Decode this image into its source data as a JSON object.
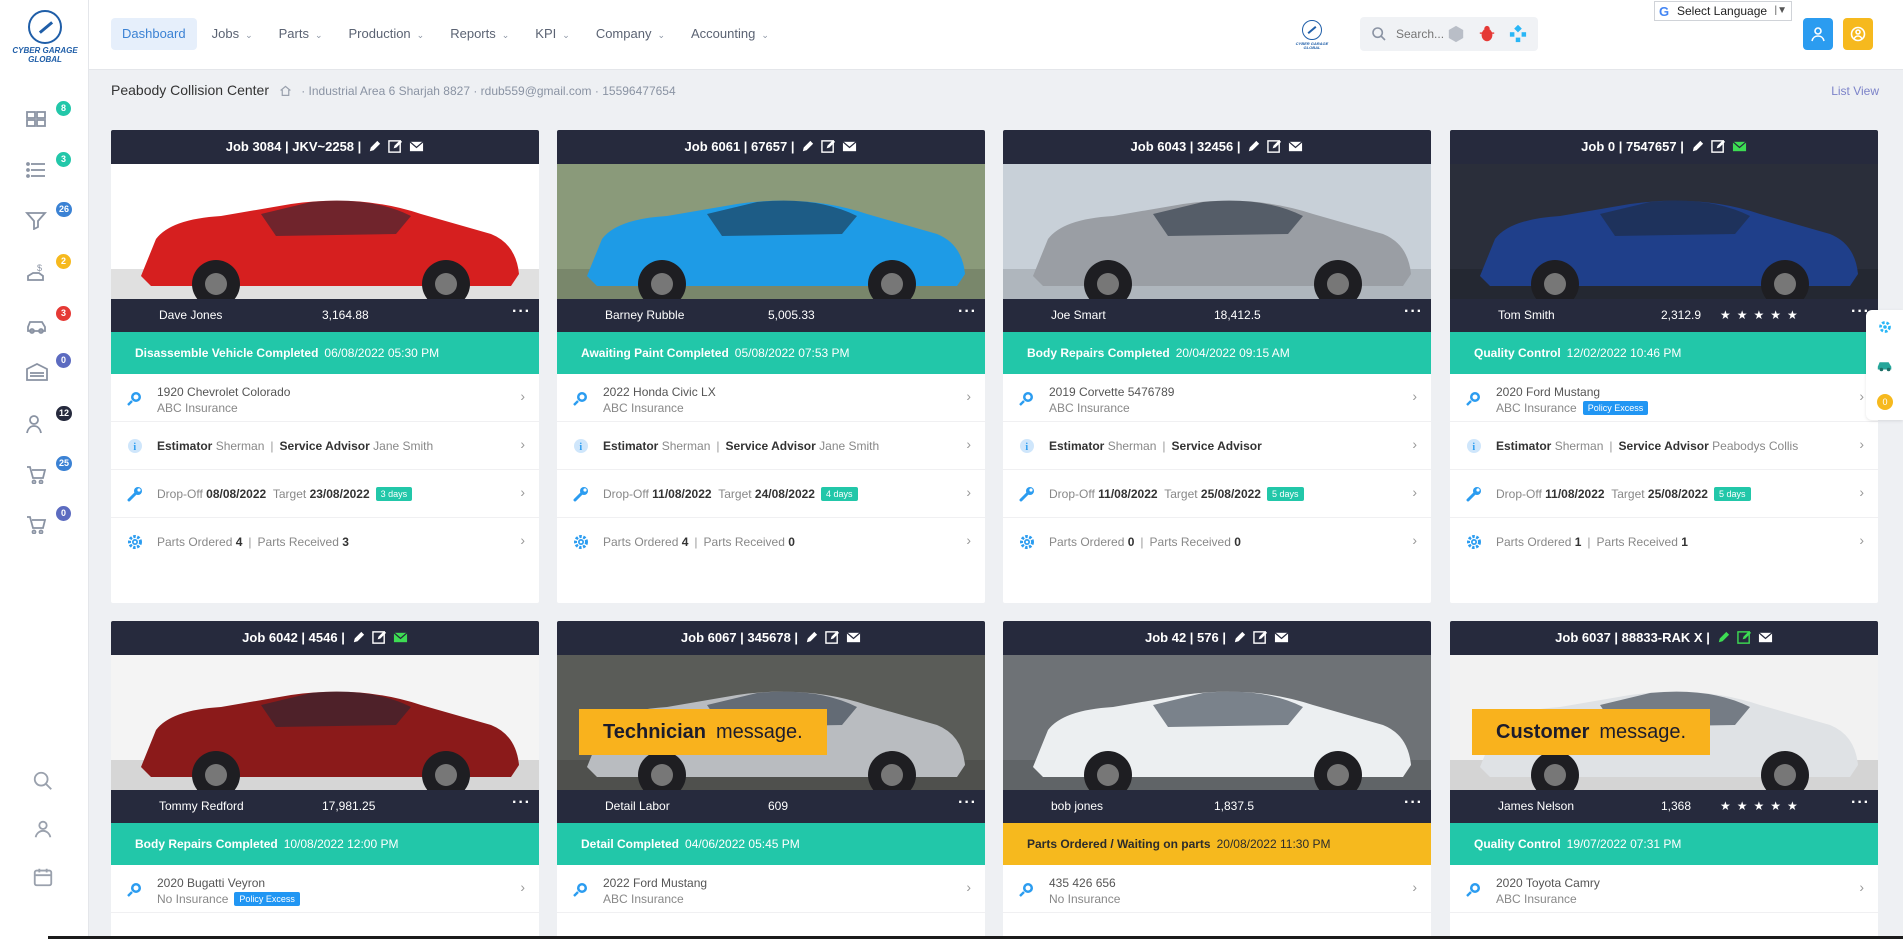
{
  "logo_text": "CYBER GARAGE GLOBAL",
  "sidebar": {
    "items": [
      {
        "name": "dashboard",
        "badge": "8",
        "color": "#22c7a9"
      },
      {
        "name": "list",
        "badge": "3",
        "color": "#22c7a9"
      },
      {
        "name": "parts-cart",
        "badge": "26",
        "color": "#3b82d4"
      },
      {
        "name": "payments",
        "badge": "2",
        "color": "#f6b91e"
      },
      {
        "name": "vehicles",
        "badge": "3",
        "color": "#e53935"
      },
      {
        "name": "garage",
        "badge": "0",
        "color": "#5c6bc0"
      },
      {
        "name": "users",
        "badge": "12",
        "color": "#262a3d"
      },
      {
        "name": "cart",
        "badge": "25",
        "color": "#3b82d4"
      },
      {
        "name": "cart-2",
        "badge": "0",
        "color": "#5c6bc0"
      }
    ]
  },
  "nav": {
    "items": [
      {
        "label": "Dashboard",
        "active": true,
        "dropdown": false
      },
      {
        "label": "Jobs",
        "dropdown": true
      },
      {
        "label": "Parts",
        "dropdown": true
      },
      {
        "label": "Production",
        "dropdown": true
      },
      {
        "label": "Reports",
        "dropdown": true
      },
      {
        "label": "KPI",
        "dropdown": true
      },
      {
        "label": "Company",
        "dropdown": true
      },
      {
        "label": "Accounting",
        "dropdown": true
      }
    ]
  },
  "search": {
    "placeholder": "Search..."
  },
  "language": {
    "label": "Select Language"
  },
  "breadcrumb": {
    "title": "Peabody Collision Center",
    "address": "· Industrial Area 6 Sharjah 8827 · rdub559@gmail.com · 15596477654"
  },
  "list_view": "List View",
  "float_badge": "0",
  "cards": [
    {
      "title": "Job 3084 | JKV~2258 |",
      "customer": "Dave Jones",
      "amount": "3,164.88",
      "stars": "",
      "status_label": "Disassemble Vehicle Completed",
      "status_date": "06/08/2022 05:30 PM",
      "status_color": "teal",
      "vehicle": "1920 Chevrolet Colorado",
      "insurance": "ABC Insurance",
      "policy": "",
      "estimator": "Sherman",
      "advisor": "Jane Smith",
      "dropoff": "08/08/2022",
      "target": "23/08/2022",
      "days": "3 days",
      "parts_ordered": "4",
      "parts_received": "3",
      "car_color": "#d61f1f",
      "bg": "#ffffff",
      "message": "",
      "msg_word": ""
    },
    {
      "title": "Job 6061 | 67657 |",
      "customer": "Barney Rubble",
      "amount": "5,005.33",
      "stars": "",
      "status_label": "Awaiting Paint Completed",
      "status_date": "05/08/2022 07:53 PM",
      "status_color": "teal",
      "vehicle": "2022 Honda Civic LX",
      "insurance": "ABC Insurance",
      "policy": "",
      "estimator": "Sherman",
      "advisor": "Jane Smith",
      "dropoff": "11/08/2022",
      "target": "24/08/2022",
      "days": "4 days",
      "parts_ordered": "4",
      "parts_received": "0",
      "car_color": "#1e9be6",
      "bg": "#8a9a7a",
      "message": "",
      "msg_word": ""
    },
    {
      "title": "Job 6043 | 32456 |",
      "customer": "Joe Smart",
      "amount": "18,412.5",
      "stars": "",
      "status_label": "Body Repairs Completed",
      "status_date": "20/04/2022 09:15 AM",
      "status_color": "teal",
      "vehicle": "2019 Corvette 5476789",
      "insurance": "ABC Insurance",
      "policy": "",
      "estimator": "Sherman",
      "advisor": "",
      "dropoff": "11/08/2022",
      "target": "25/08/2022",
      "days": "5 days",
      "parts_ordered": "0",
      "parts_received": "0",
      "car_color": "#9a9ea4",
      "bg": "#c8d0d8",
      "message": "",
      "msg_word": ""
    },
    {
      "title": "Job 0 | 7547657 |",
      "customer": "Tom Smith",
      "amount": "2,312.9",
      "stars": "★★★★★",
      "status_label": "Quality Control",
      "status_date": "12/02/2022 10:46 PM",
      "status_color": "teal",
      "vehicle": "2020 Ford Mustang",
      "insurance": "ABC Insurance",
      "policy": "Policy Excess",
      "estimator": "Sherman",
      "advisor": "Peabodys Collis",
      "dropoff": "11/08/2022",
      "target": "25/08/2022",
      "days": "5 days",
      "parts_ordered": "1",
      "parts_received": "1",
      "car_color": "#1f3f8a",
      "bg": "#2a2e3a",
      "message": "",
      "msg_word": ""
    },
    {
      "title": "Job 6042 | 4546 |",
      "customer": "Tommy Redford",
      "amount": "17,981.25",
      "stars": "",
      "status_label": "Body Repairs Completed",
      "status_date": "10/08/2022 12:00 PM",
      "status_color": "teal",
      "vehicle": "2020 Bugatti Veyron",
      "insurance": "No Insurance",
      "policy": "Policy Excess",
      "car_color": "#8b1a1a",
      "bg": "#f4f4f4",
      "message": "",
      "msg_word": ""
    },
    {
      "title": "Job 6067 | 345678 |",
      "customer": "Detail Labor",
      "amount": "609",
      "stars": "",
      "status_label": "Detail Completed",
      "status_date": "04/06/2022 05:45 PM",
      "status_color": "teal",
      "vehicle": "2022 Ford Mustang",
      "insurance": "ABC Insurance",
      "policy": "",
      "car_color": "#b9bcc0",
      "bg": "#5a5c58",
      "message": "Technician",
      "msg_word": "message."
    },
    {
      "title": "Job 42 | 576 |",
      "customer": "bob jones",
      "amount": "1,837.5",
      "stars": "",
      "status_label": "Parts Ordered / Waiting on parts",
      "status_date": "20/08/2022 11:30 PM",
      "status_color": "orange",
      "vehicle": "435 426 656",
      "insurance": "No Insurance",
      "policy": "",
      "car_color": "#eceff1",
      "bg": "#6e7276",
      "message": "",
      "msg_word": ""
    },
    {
      "title": "Job 6037 | 88833-RAK X |",
      "customer": "James Nelson",
      "amount": "1,368",
      "stars": "★★★★★",
      "status_label": "Quality Control",
      "status_date": "19/07/2022 07:31 PM",
      "status_color": "teal",
      "vehicle": "2020 Toyota Camry",
      "insurance": "ABC Insurance",
      "policy": "",
      "car_color": "#dfe2e5",
      "bg": "#f2f2f2",
      "message": "Customer",
      "msg_word": "message."
    }
  ],
  "labels": {
    "estimator": "Estimator",
    "advisor": "Service Advisor",
    "dropoff": "Drop-Off",
    "target": "Target",
    "parts_ordered": "Parts Ordered",
    "parts_received": "Parts Received"
  }
}
